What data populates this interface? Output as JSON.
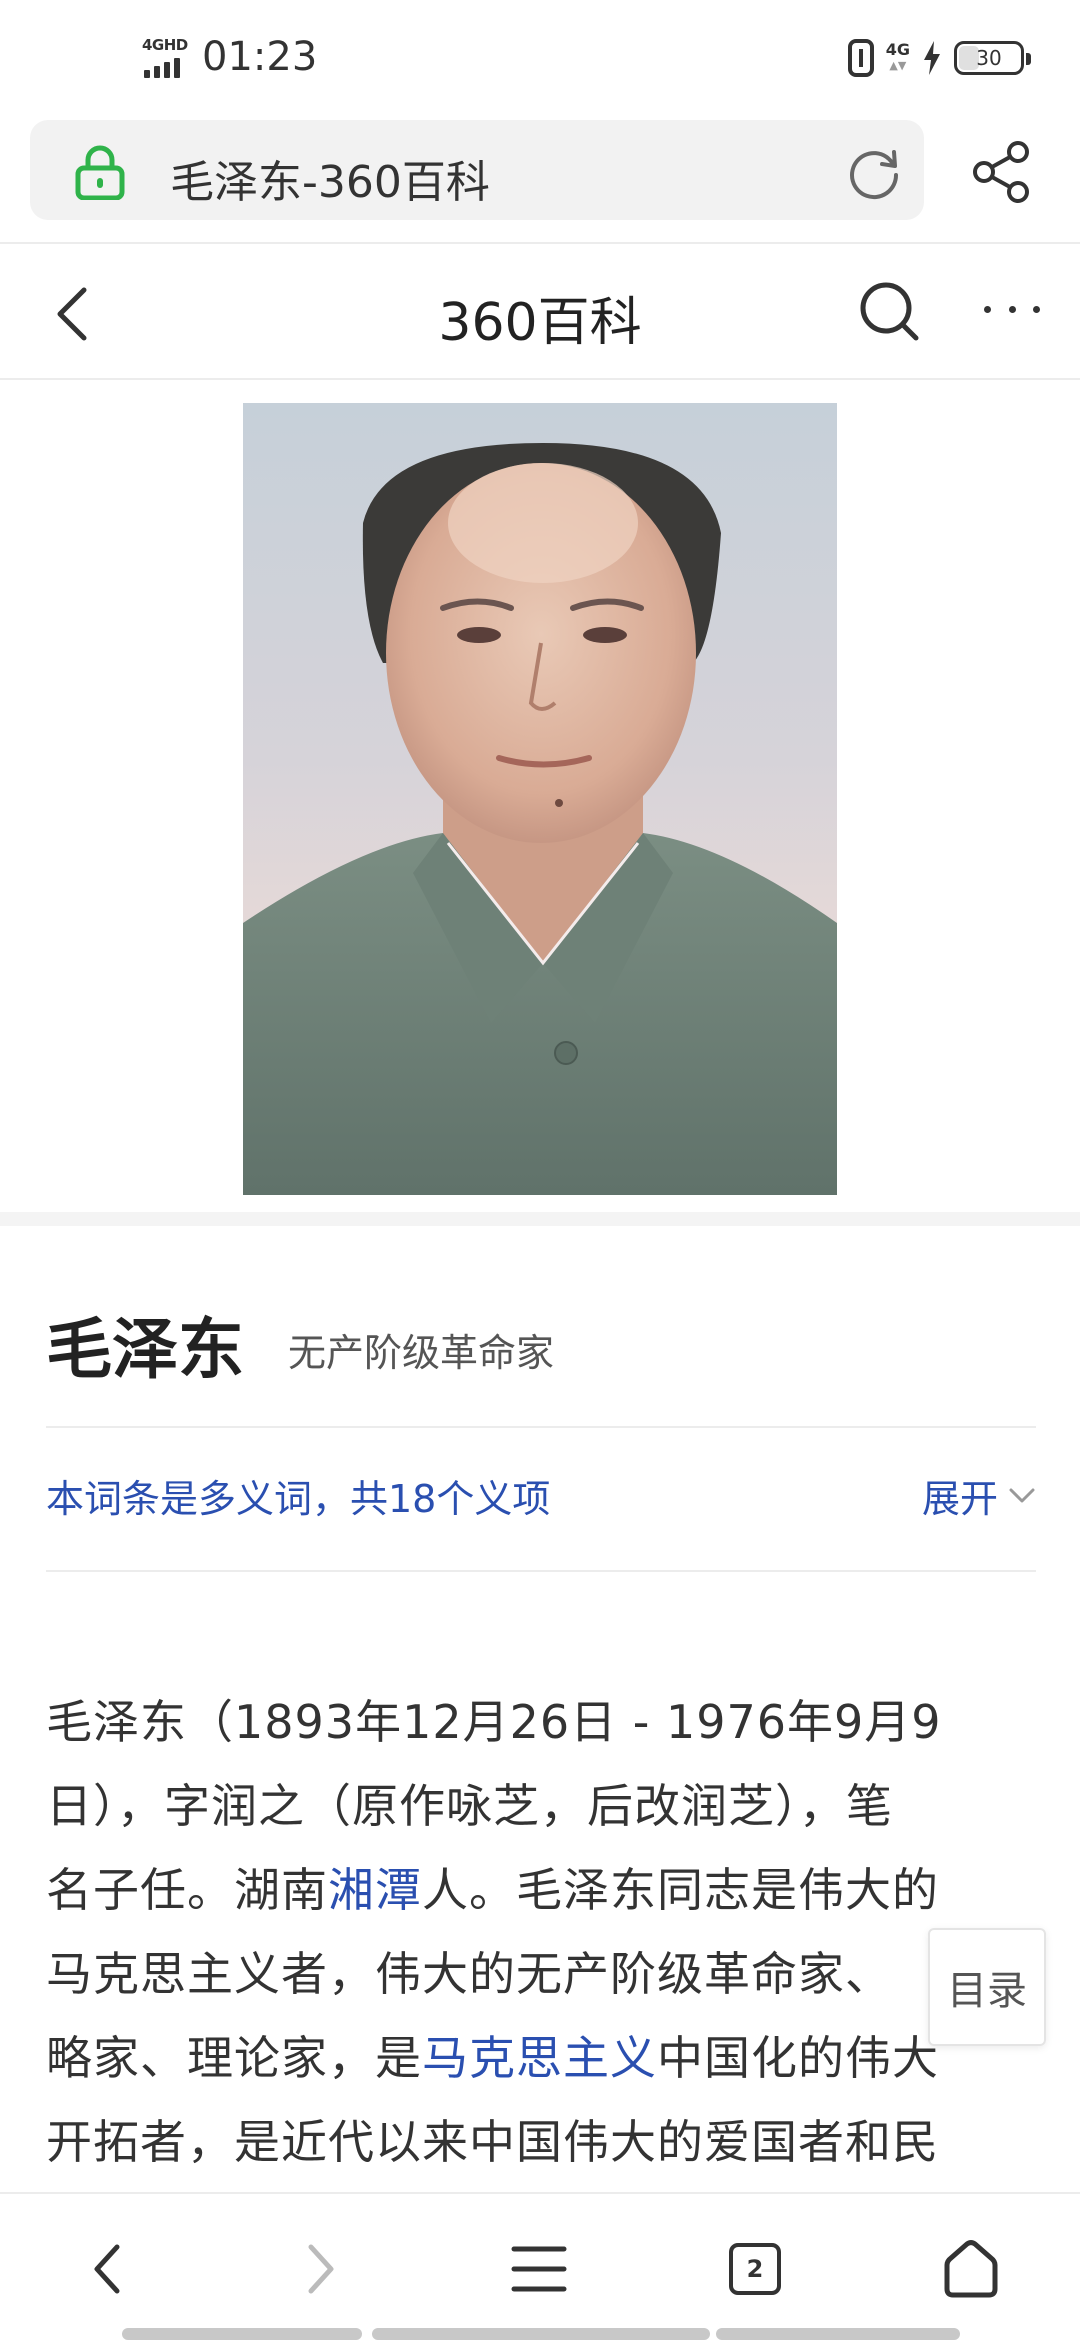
{
  "status_bar": {
    "network_tag": "4GHD",
    "time": "01:23",
    "network_right": "4G",
    "battery": "30"
  },
  "address_bar": {
    "url_text": "毛泽东-360百科"
  },
  "page_header": {
    "title": "360百科"
  },
  "entry": {
    "title": "毛泽东",
    "subtitle": "无产阶级革命家",
    "polysemy_text": "本词条是多义词，共18个义项",
    "expand_label": "展开"
  },
  "article": {
    "line1": "毛泽东（1893年12月26日 - 1976年9月9",
    "line2": "日），字润之（原作咏芝，后改润芝），笔",
    "line3_a": "名子任。湖南",
    "line3_link": "湘潭",
    "line3_b": "人。毛泽东同志是伟大的",
    "line4": "马克思主义者，伟大的无产阶级革命家、",
    "line5_a": "略家、理论家，是",
    "line5_link": "马克思主义",
    "line5_b": "中国化的伟大",
    "line6": "开拓者，是近代以来中国伟大的爱国者和民"
  },
  "toc": {
    "label": "目录"
  },
  "bottom_nav": {
    "tab_count": "2"
  },
  "colors": {
    "link": "#2a4fb0",
    "lock_green": "#2fb34a",
    "uniform_gray": "#6f8378"
  },
  "icons": [
    "signal-icon",
    "bluetooth-icon",
    "charging-icon",
    "battery-icon",
    "lock-icon",
    "reload-icon",
    "share-icon",
    "back-icon",
    "search-icon",
    "more-icon",
    "chevron-down-icon",
    "nav-back-icon",
    "nav-forward-icon",
    "menu-icon",
    "tabs-icon",
    "home-icon"
  ]
}
